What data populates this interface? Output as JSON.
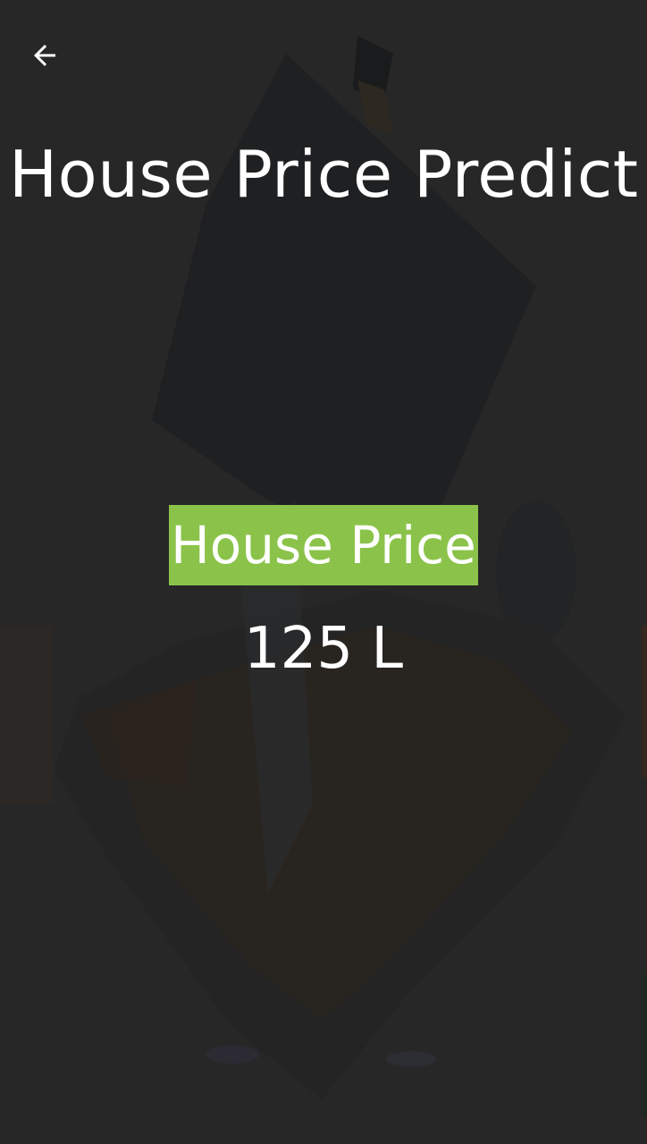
{
  "header": {
    "back_icon": "arrow-back-icon",
    "title": "House Price Predict"
  },
  "result": {
    "label": "House Price",
    "value": "125 L"
  },
  "colors": {
    "background": "#272727",
    "label_highlight": "#8bc34a",
    "text": "#ffffff"
  },
  "background_image": "house-illustration"
}
